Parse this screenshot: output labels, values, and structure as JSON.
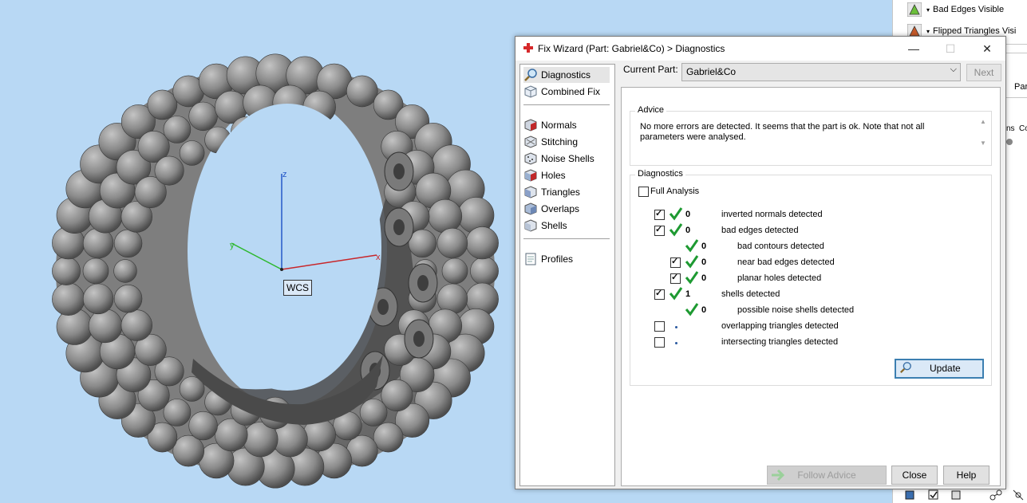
{
  "right_panel": {
    "items": [
      "Bad Edges Visible",
      "Flipped Triangles Visi"
    ],
    "partial_labels": [
      "Part",
      "ns",
      "Co"
    ]
  },
  "viewport": {
    "wcs_label": "WCS",
    "axis_x": "x",
    "axis_y": "y",
    "axis_z": "z"
  },
  "dialog": {
    "title": "Fix Wizard (Part: Gabriel&Co) > Diagnostics",
    "minimize": "—",
    "maximize": "☐",
    "close": "✕",
    "current_part_label": "Current Part:",
    "current_part_value": "Gabriel&Co",
    "next_label": "Next",
    "nav": [
      {
        "label": "Diagnostics",
        "icon": "magnifier-icon"
      },
      {
        "label": "Combined Fix",
        "icon": "cube-icon"
      },
      {
        "label": "Normals",
        "icon": "normals-cube-icon"
      },
      {
        "label": "Stitching",
        "icon": "stitching-cube-icon"
      },
      {
        "label": "Noise Shells",
        "icon": "noise-shells-icon"
      },
      {
        "label": "Holes",
        "icon": "holes-cube-icon"
      },
      {
        "label": "Triangles",
        "icon": "triangles-cube-icon"
      },
      {
        "label": "Overlaps",
        "icon": "overlaps-cube-icon"
      },
      {
        "label": "Shells",
        "icon": "shells-cube-icon"
      },
      {
        "label": "Profiles",
        "icon": "document-icon"
      }
    ],
    "advice_title": "Advice",
    "advice_text": "No more errors are detected. It seems that the part is ok. Note that not all parameters were analysed.",
    "diagnostics_title": "Diagnostics",
    "full_analysis_label": "Full Analysis",
    "full_analysis_checked": false,
    "rows": [
      {
        "checked": true,
        "status": "ok",
        "count": "0",
        "label": "inverted normals detected",
        "indent": 0
      },
      {
        "checked": true,
        "status": "ok",
        "count": "0",
        "label": "bad edges detected",
        "indent": 0
      },
      {
        "checked": null,
        "status": "ok",
        "count": "0",
        "label": "bad contours detected",
        "indent": 1
      },
      {
        "checked": true,
        "status": "ok",
        "count": "0",
        "label": "near bad edges detected",
        "indent": 1
      },
      {
        "checked": true,
        "status": "ok",
        "count": "0",
        "label": "planar holes detected",
        "indent": 1
      },
      {
        "checked": true,
        "status": "ok",
        "count": "1",
        "label": "shells detected",
        "indent": 0
      },
      {
        "checked": null,
        "status": "ok",
        "count": "0",
        "label": "possible noise shells detected",
        "indent": 1
      },
      {
        "checked": false,
        "status": "none",
        "count": "",
        "label": "overlapping triangles detected",
        "indent": 0
      },
      {
        "checked": false,
        "status": "none",
        "count": "",
        "label": "intersecting triangles detected",
        "indent": 0
      }
    ],
    "update_label": "Update",
    "follow_advice_label": "Follow Advice",
    "close_label": "Close",
    "help_label": "Help"
  },
  "colors": {
    "viewport_bg": "#b8d8f4",
    "check_green": "#1e9a32",
    "axis_x": "#c8262a",
    "axis_y": "#2cb82c",
    "axis_z": "#2458c8"
  }
}
